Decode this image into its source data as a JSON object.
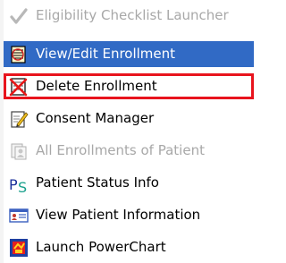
{
  "menu": {
    "items": [
      {
        "label": "Eligibility Checklist Launcher",
        "icon": "checkmark-icon",
        "state": "disabled"
      },
      {
        "label": "View/Edit Enrollment",
        "icon": "enrollment-edit-icon",
        "state": "selected"
      },
      {
        "label": "Delete Enrollment",
        "icon": "delete-enrollment-icon",
        "state": "highlighted"
      },
      {
        "label": "Consent Manager",
        "icon": "consent-pencil-icon",
        "state": "enabled"
      },
      {
        "label": "All Enrollments of Patient",
        "icon": "enrollments-list-icon",
        "state": "disabled"
      },
      {
        "label": "Patient Status Info",
        "icon": "ps-status-icon",
        "state": "enabled"
      },
      {
        "label": "View Patient Information",
        "icon": "patient-card-icon",
        "state": "enabled"
      },
      {
        "label": "Launch PowerChart",
        "icon": "powerchart-icon",
        "state": "enabled"
      }
    ]
  },
  "colors": {
    "selection": "#316ac5",
    "highlight_border": "#e8141d",
    "disabled_text": "#a8a8a8"
  }
}
